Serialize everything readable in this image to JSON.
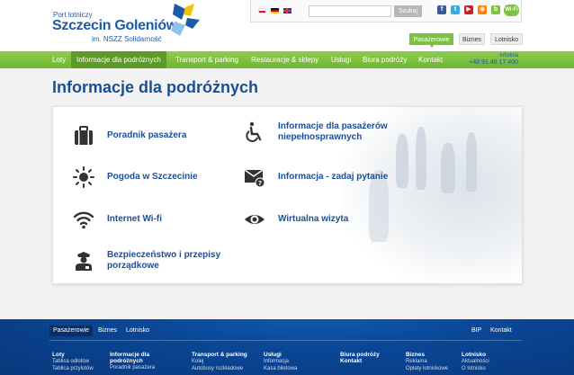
{
  "logo": {
    "top": "Port lotniczy",
    "main": "Szczecin Goleniów",
    "sub": "im. NSZZ Solidarność"
  },
  "topbar": {
    "search_placeholder": "",
    "search_button": "Szukaj",
    "wifi_badge": "Wi-Fi"
  },
  "section_tabs": [
    "Pasażerowie",
    "Biznes",
    "Lotnisko"
  ],
  "nav": {
    "items": [
      "Loty",
      "Informacje dla podróżnych",
      "Transport & parking",
      "Restauracje & sklepy",
      "Usługi",
      "Biura podróży",
      "Kontakt"
    ],
    "infoline_label": "Infolinia",
    "infoline_phone": "+48 91 48 17 400"
  },
  "page": {
    "title": "Informacje dla podróżnych"
  },
  "items": [
    {
      "label": "Poradnik pasażera",
      "icon": "suitcase-icon"
    },
    {
      "label": "Informacje dla pasażerów niepełnosprawnych",
      "icon": "wheelchair-icon"
    },
    {
      "label": "Pogoda w Szczecinie",
      "icon": "sun-icon"
    },
    {
      "label": "Informacja - zadaj pytanie",
      "icon": "mail-question-icon"
    },
    {
      "label": "Internet Wi-fi",
      "icon": "wifi-icon"
    },
    {
      "label": "Wirtualna wizyta",
      "icon": "eye-icon"
    },
    {
      "label": "Bezpieczeństwo i przepisy porządkowe",
      "icon": "security-officer-icon"
    }
  ],
  "footer": {
    "tabs": [
      "Pasażerowie",
      "Biznes",
      "Lotnisko"
    ],
    "right_links": [
      "BIP",
      "Kontakt"
    ],
    "columns": [
      {
        "title": "Loty",
        "links": [
          "Tablica odlotów",
          "Tablica przylotów"
        ]
      },
      {
        "title": "Informacje dla podróżnych",
        "links": [
          "Poradnik pasażera"
        ]
      },
      {
        "title": "Transport & parking",
        "links": [
          "Kolej",
          "Autobusy rozkładowe"
        ]
      },
      {
        "title": "Usługi",
        "links": [
          "Informacja",
          "Kasa biletowa"
        ]
      },
      {
        "title": "Biura podróży",
        "links": [
          "Kontakt"
        ]
      },
      {
        "title": "Biznes",
        "links": [
          "Reklama",
          "Opłaty lotniskowe"
        ]
      },
      {
        "title": "Lotnisko",
        "links": [
          "Aktualności",
          "O lotnisku"
        ]
      }
    ]
  },
  "colors": {
    "nav_green": "#7bc142",
    "nav_active": "#5b9b26",
    "brand_blue": "#1d4e94",
    "footer_blue": "#0a4796",
    "logo_yellow": "#f5c400",
    "logo_blue": "#1d5aa8",
    "logo_light_blue": "#8ec3ea"
  }
}
